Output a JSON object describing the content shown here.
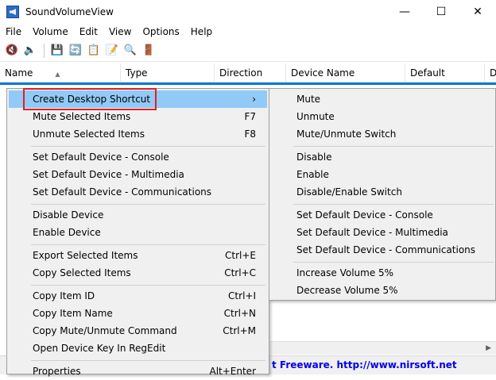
{
  "window": {
    "title": "SoundVolumeView",
    "minimize": "—",
    "maximize": "☐",
    "close": "✕"
  },
  "menubar": [
    "File",
    "Volume",
    "Edit",
    "View",
    "Options",
    "Help"
  ],
  "toolbar": [
    {
      "icon": "mute-speaker-icon",
      "glyph": "🔇"
    },
    {
      "icon": "speaker-icon",
      "glyph": "🔈"
    },
    {
      "icon": "save-icon",
      "glyph": "💾"
    },
    {
      "icon": "refresh-icon",
      "glyph": "🔄"
    },
    {
      "icon": "copy-icon",
      "glyph": "📋"
    },
    {
      "icon": "properties-icon",
      "glyph": "📝"
    },
    {
      "icon": "find-icon",
      "glyph": "🔍"
    },
    {
      "icon": "exit-icon",
      "glyph": "🚪"
    }
  ],
  "columns": [
    "Name",
    "Type",
    "Direction",
    "Device Name",
    "Default",
    "D"
  ],
  "context_menu": [
    {
      "label": "Create Desktop Shortcut",
      "key": "›"
    },
    {
      "label": "Mute Selected Items",
      "key": "F7"
    },
    {
      "label": "Unmute Selected Items",
      "key": "F8"
    },
    {
      "label": "Set Default Device - Console",
      "key": ""
    },
    {
      "label": "Set Default Device - Multimedia",
      "key": ""
    },
    {
      "label": "Set Default Device - Communications",
      "key": ""
    },
    {
      "label": "Disable Device",
      "key": ""
    },
    {
      "label": "Enable Device",
      "key": ""
    },
    {
      "label": "Export Selected Items",
      "key": "Ctrl+E"
    },
    {
      "label": "Copy Selected Items",
      "key": "Ctrl+C"
    },
    {
      "label": "Copy Item ID",
      "key": "Ctrl+I"
    },
    {
      "label": "Copy Item Name",
      "key": "Ctrl+N"
    },
    {
      "label": "Copy Mute/Unmute Command",
      "key": "Ctrl+M"
    },
    {
      "label": "Open Device Key In RegEdit",
      "key": ""
    },
    {
      "label": "Properties",
      "key": "Alt+Enter"
    }
  ],
  "submenu": [
    "Mute",
    "Unmute",
    "Mute/Unmute Switch",
    "Disable",
    "Enable",
    "Disable/Enable Switch",
    "Set Default Device - Console",
    "Set Default Device - Multimedia",
    "Set Default Device - Communications",
    "Increase Volume 5%",
    "Decrease Volume 5%"
  ],
  "status": {
    "text": "t Freeware.  http://www.nirsoft.net"
  },
  "colors": {
    "highlight": "#91c9f7",
    "selection": "#0078d7",
    "annotation_box": "#e02020",
    "link": "#0000ee"
  }
}
